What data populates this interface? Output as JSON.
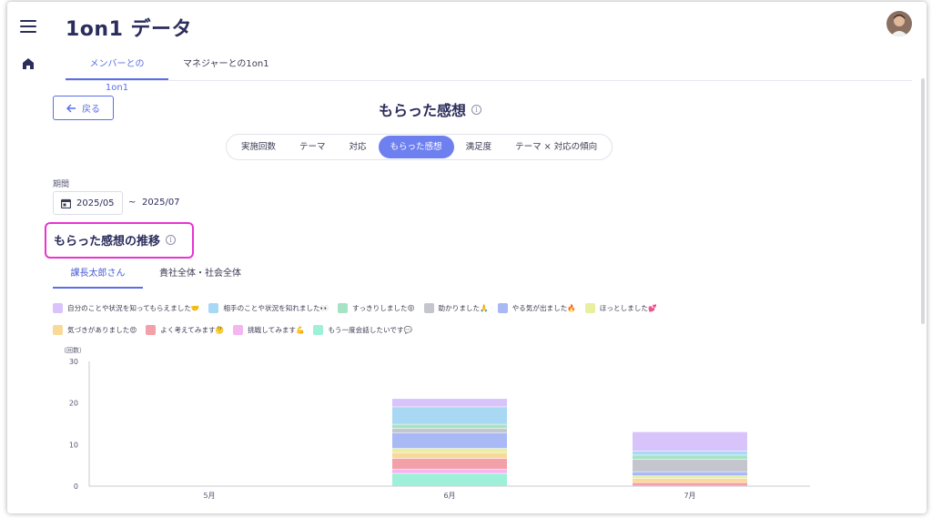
{
  "app": {
    "title": "1on1 データ"
  },
  "nav": {
    "menu_icon": "hamburger-icon",
    "home_icon": "home-icon"
  },
  "top_tabs": [
    {
      "label": "メンバーとの1on1",
      "active": true
    },
    {
      "label": "マネジャーとの1on1",
      "active": false
    }
  ],
  "back_button": {
    "label": "戻る"
  },
  "page_title": "もらった感想",
  "segments": [
    {
      "label": "実施回数",
      "active": false
    },
    {
      "label": "テーマ",
      "active": false
    },
    {
      "label": "対応",
      "active": false
    },
    {
      "label": "もらった感想",
      "active": true
    },
    {
      "label": "満足度",
      "active": false
    },
    {
      "label": "テーマ × 対応の傾向",
      "active": false
    }
  ],
  "period": {
    "label": "期間",
    "start": "2025/05",
    "separator": "~",
    "end": "2025/07"
  },
  "section_title": "もらった感想の推移",
  "sub_tabs": [
    {
      "label": "課長太郎さん",
      "active": true
    },
    {
      "label": "貴社全体・社会全体",
      "active": false
    }
  ],
  "colors": {
    "accent": "#6e80ef",
    "highlight": "#e933d3",
    "title": "#2b2d5c"
  },
  "chart_data": {
    "type": "bar",
    "stacked": true,
    "unit_label": "（回数）",
    "categories": [
      "5月",
      "6月",
      "7月"
    ],
    "ylim": [
      0,
      30
    ],
    "yticks": [
      0,
      10,
      20,
      30
    ],
    "grid": false,
    "legend_position": "top",
    "series": [
      {
        "name": "もう一度会話したいです💬",
        "color": "#9ff0d9",
        "values": [
          0,
          3,
          0
        ]
      },
      {
        "name": "挑戦してみます💪",
        "color": "#f5b5f0",
        "values": [
          0,
          1,
          0
        ]
      },
      {
        "name": "よく考えてみます🤔",
        "color": "#f4a0a8",
        "values": [
          0,
          2.6,
          0.8
        ]
      },
      {
        "name": "気づきがありました😍",
        "color": "#f9d99a",
        "values": [
          0,
          1.4,
          1
        ]
      },
      {
        "name": "ほっとしました💕",
        "color": "#e8ef9f",
        "values": [
          0,
          1,
          0.6
        ]
      },
      {
        "name": "やる気が出ました🔥",
        "color": "#a9b9f6",
        "values": [
          0,
          3.8,
          1
        ]
      },
      {
        "name": "助かりました🙏",
        "color": "#c5c6cd",
        "values": [
          0,
          1,
          3
        ]
      },
      {
        "name": "すっきりしました😝",
        "color": "#a6e3c4",
        "values": [
          0,
          1,
          1
        ]
      },
      {
        "name": "相手のことや状況を知れました👀",
        "color": "#a8d8f4",
        "values": [
          0,
          4.2,
          1
        ]
      },
      {
        "name": "自分のことや状況を知ってもらえました🤝",
        "color": "#d8c3fb",
        "values": [
          0,
          2,
          4.6
        ]
      }
    ]
  }
}
